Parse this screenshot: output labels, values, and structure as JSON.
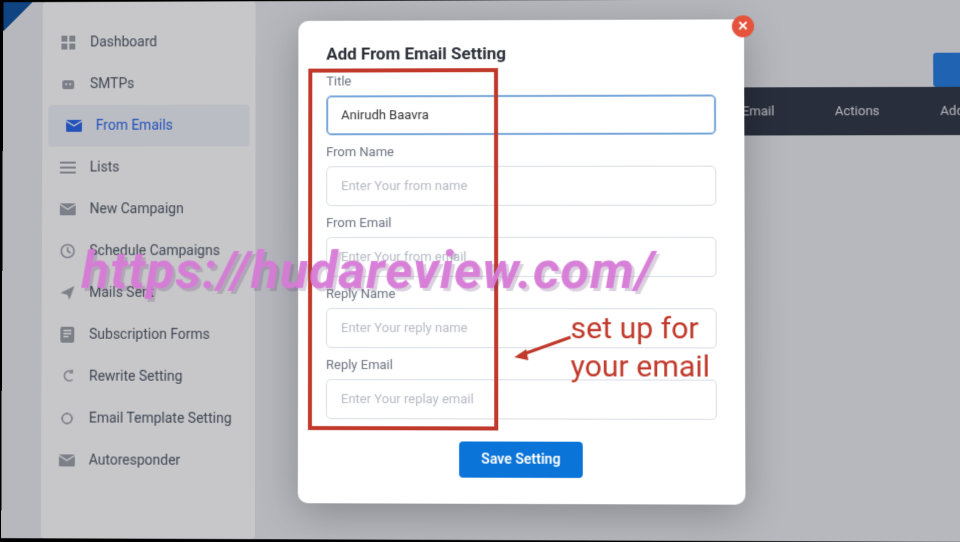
{
  "sidebar": {
    "items": [
      {
        "label": "Dashboard",
        "icon": "grid"
      },
      {
        "label": "SMTPs",
        "icon": "robot"
      },
      {
        "label": "From Emails",
        "icon": "mail"
      },
      {
        "label": "Lists",
        "icon": "list"
      },
      {
        "label": "New Campaign",
        "icon": "mailplus"
      },
      {
        "label": "Schedule Campaigns",
        "icon": "clock"
      },
      {
        "label": "Mails Sent",
        "icon": "send"
      },
      {
        "label": "Subscription Forms",
        "icon": "form"
      },
      {
        "label": "Rewrite Setting",
        "icon": "rewrite"
      },
      {
        "label": "Email Template Setting",
        "icon": "template"
      },
      {
        "label": "Autoresponder",
        "icon": "auto"
      }
    ],
    "active_index": 2
  },
  "topbar": {
    "col_reply": "Reply Email",
    "col_actions": "Actions",
    "col_add": "Add"
  },
  "modal": {
    "title": "Add From Email Setting",
    "close_glyph": "✕",
    "fields": {
      "title_label": "Title",
      "title_value": "Anirudh Baavra",
      "from_name_label": "From Name",
      "from_name_placeholder": "Enter Your from name",
      "from_email_label": "From Email",
      "from_email_placeholder": "Enter Your from email",
      "reply_name_label": "Reply Name",
      "reply_name_placeholder": "Enter Your reply name",
      "reply_email_label": "Reply Email",
      "reply_email_placeholder": "Enter Your replay email"
    },
    "save_label": "Save Setting"
  },
  "annotation": {
    "text_line1": "set up for",
    "text_line2": "your email"
  },
  "watermark": "https://hudareview.com/"
}
